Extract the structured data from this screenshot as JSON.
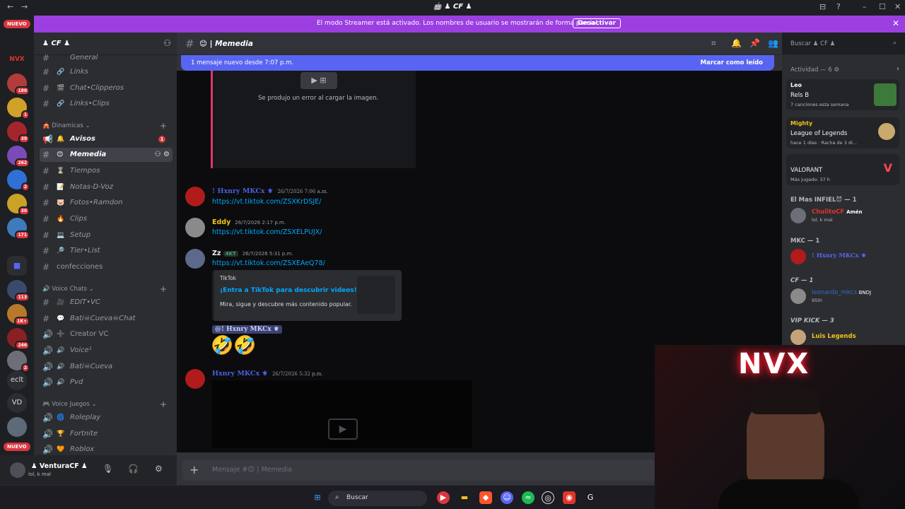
{
  "window": {
    "title": "🤖 ♟ CF ♟",
    "back": "←",
    "forward": "→",
    "controls": [
      "⊟",
      "?",
      "–",
      "☐",
      "✕"
    ]
  },
  "banner": {
    "text": "El modo Streamer está activado. Los nombres de usuario se mostrarán de forma parcial.",
    "button": "Desactivar",
    "close": "✕"
  },
  "rail": {
    "nuevo_top": "NUEVO",
    "nuevo_bottom": "NUEVO",
    "servers": [
      {
        "label": "NVX",
        "badge": ""
      },
      {
        "label": "",
        "badge": "180"
      },
      {
        "label": "",
        "badge": "1"
      },
      {
        "label": "",
        "badge": "39"
      },
      {
        "label": "",
        "badge": "262"
      },
      {
        "label": "",
        "badge": "2"
      },
      {
        "label": "",
        "badge": "30"
      },
      {
        "label": "",
        "badge": "171"
      },
      {
        "label": "",
        "badge": ""
      },
      {
        "label": "",
        "badge": "113"
      },
      {
        "label": "",
        "badge": "1K+"
      },
      {
        "label": "",
        "badge": "246"
      },
      {
        "label": "",
        "badge": "2"
      }
    ],
    "text_servers": [
      "eclt",
      "VD"
    ]
  },
  "sidebar": {
    "server_name": "♟ CF ♟",
    "channels_top": [
      {
        "emoji": "",
        "name": "General"
      },
      {
        "emoji": "🔗",
        "name": "Links"
      },
      {
        "emoji": "🎬",
        "name": "Chat•Clipperos"
      },
      {
        "emoji": "🔗",
        "name": "Links•Clips"
      }
    ],
    "cat_dinamicas": "Dinamicas",
    "channels_din": [
      {
        "emoji": "🔔",
        "name": "Avisos",
        "badge": "1"
      },
      {
        "emoji": "😊",
        "name": "Memedia"
      },
      {
        "emoji": "⌛",
        "name": "Tiempos"
      },
      {
        "emoji": "📝",
        "name": "Notas-D-Voz"
      },
      {
        "emoji": "🐷",
        "name": "Fotos•Ramdon"
      },
      {
        "emoji": "🔥",
        "name": "Clips"
      },
      {
        "emoji": "💻",
        "name": "Setup"
      },
      {
        "emoji": "🔎",
        "name": "Tier•List"
      },
      {
        "emoji": "",
        "name": "confecciones"
      }
    ],
    "cat_voice": "Voice Chats",
    "channels_voice": [
      {
        "emoji": "🎥",
        "name": "EDIT•VC"
      },
      {
        "emoji": "💬",
        "name": "Bati☠Cueva☠Chat"
      },
      {
        "emoji": "➕",
        "name": "Creator VC"
      },
      {
        "emoji": "🔊",
        "name": "Voice¹"
      },
      {
        "emoji": "🔊",
        "name": "Bati☠Cueva"
      },
      {
        "emoji": "🔊",
        "name": "Pvd"
      }
    ],
    "cat_juegos": "Voice Juegos",
    "channels_juegos": [
      {
        "emoji": "🌀",
        "name": "Roleplay"
      },
      {
        "emoji": "🏆",
        "name": "Fortnite"
      },
      {
        "emoji": "🧡",
        "name": "Roblox"
      }
    ]
  },
  "user": {
    "name": "♟ VenturaCF ♟",
    "status": "lol, k mal"
  },
  "chat": {
    "channel": "😊 | Memedia",
    "search_placeholder": "Buscar ♟ CF ♟",
    "new_messages": "1 mensaje nuevo desde 7:07 p.m.",
    "mark_read": "Marcar como leído",
    "image_error": "Se produjo un error al cargar la imagen.",
    "messages": [
      {
        "author": "! Hxnry MKCx ⚜",
        "time": "26/7/2026 7:06 a.m.",
        "link": "https://vt.tiktok.com/ZSXKrDSJE/"
      },
      {
        "author": "Eddy",
        "time": "26/7/2026 2:17 p.m.",
        "link": "https://vt.tiktok.com/ZSXELPUJX/"
      },
      {
        "author": "Zz",
        "tag": "4KT",
        "time": "26/7/2026 5:31 p.m.",
        "link": "https://vt.tiktok.com/ZSXEAeQ78/"
      }
    ],
    "embed": {
      "provider": "TikTok",
      "title": "¡Entra a TikTok para descubrir videos!",
      "desc": "Mira, sigue y descubre más contenido popular."
    },
    "mention": "@! Hxnry MKCx ⚜",
    "emojis": "🤣🤣",
    "last": {
      "author": "Hxnry MKCx ⚜",
      "time": "26/7/2026 5:32 p.m."
    },
    "composer_placeholder": "Mensaje #😊 | Memedia"
  },
  "activity": {
    "header": "Actividad — 6",
    "cards": [
      {
        "name": "Leo",
        "game": "Rels B",
        "detail": "7 canciones esta semana"
      },
      {
        "name": "Mighty",
        "game": "League of Legends",
        "detail": "hace 1 días · Racha de 3 dí..."
      },
      {
        "name": "",
        "game": "VALORANT",
        "detail": "Más jugado: 37 h"
      }
    ]
  },
  "members": [
    {
      "cat": "El Mas INFIEL😈 — 1",
      "name": "ChulitoCF",
      "tag": "Amén",
      "status": "lol, k mal",
      "color": "#e0352b"
    },
    {
      "cat": "MKC — 1",
      "name": "! Hxnry MKCx ⚜",
      "tag": "",
      "status": "",
      "color": "#5865f2"
    },
    {
      "cat": "CF — 1",
      "name": "leonardo_mkcs",
      "tag": "BNDJ",
      "status": "95th",
      "color": "#3b68c4"
    },
    {
      "cat": "VIP KICK — 3",
      "name": "Luis Legends",
      "tag": "",
      "status": "",
      "color": "#f0c419"
    }
  ],
  "cam": {
    "sign": "NVX"
  },
  "taskbar": {
    "search": "Buscar"
  },
  "colors": {
    "banner": "#9b3fe0",
    "blurple": "#5865f2",
    "link": "#00a8fc",
    "danger": "#d9363e"
  }
}
